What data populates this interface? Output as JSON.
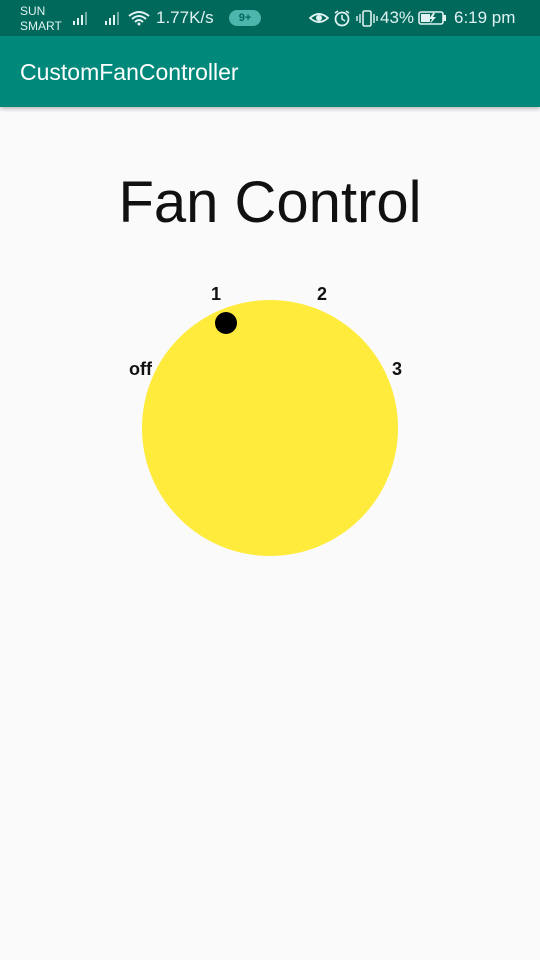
{
  "status_bar": {
    "carrier_line1": "SUN",
    "carrier_line2": "SMART",
    "network_speed": "1.77K/s",
    "notification_count": "9+",
    "battery_percent": "43%",
    "time": "6:19 pm"
  },
  "app_bar": {
    "title": "CustomFanController"
  },
  "main": {
    "title": "Fan Control",
    "dial": {
      "labels": [
        "off",
        "1",
        "2",
        "3"
      ],
      "selected": "1",
      "color": "#ffeb3b",
      "indicator_color": "#000000"
    }
  },
  "colors": {
    "status_bar": "#00695c",
    "app_bar": "#00897b",
    "background": "#fafafa"
  }
}
